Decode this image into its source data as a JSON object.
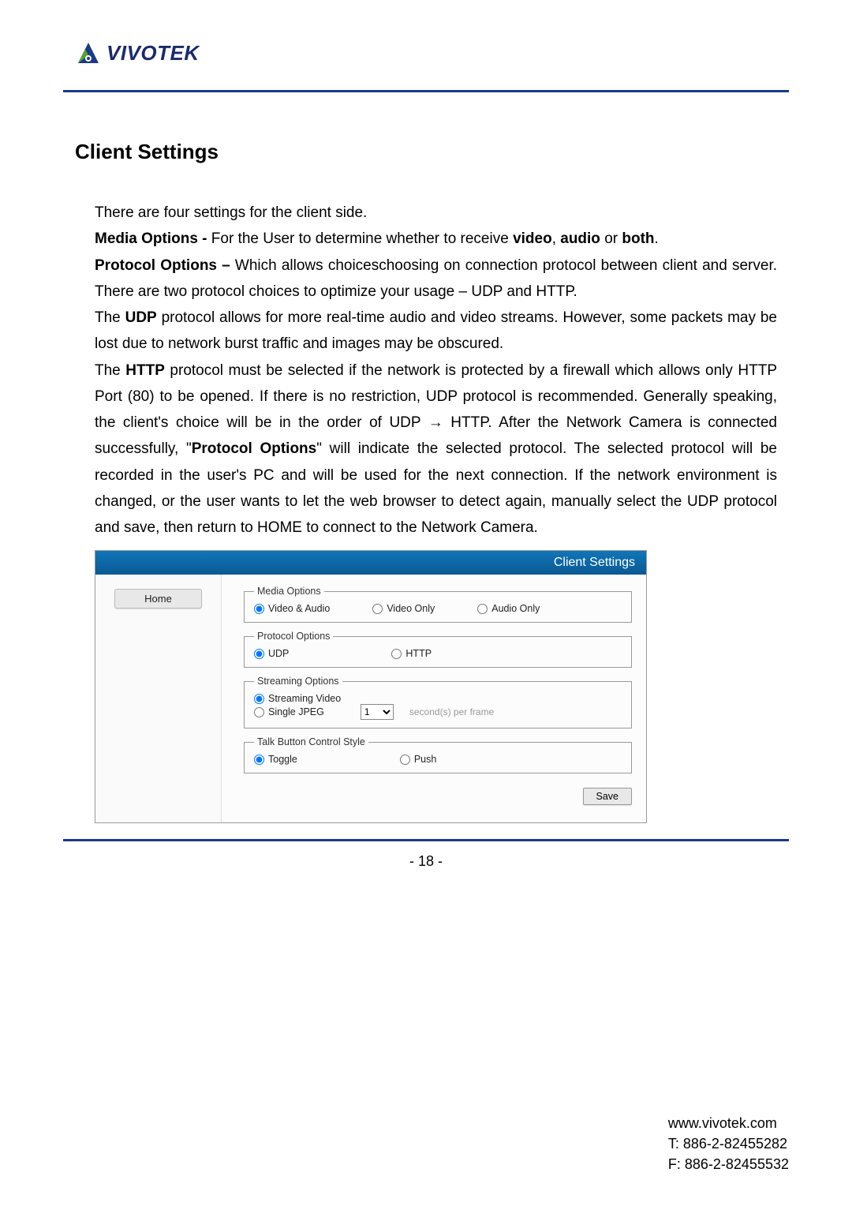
{
  "header": {
    "logo_text": "VIVOTEK"
  },
  "section": {
    "title": "Client Settings",
    "p1": "There are four settings for the client side.",
    "p2_label": "Media Options -",
    "p2_text": " For the User to determine whether to receive ",
    "p2_video": "video",
    "p2_comma": ", ",
    "p2_audio": "audio",
    "p2_or": " or ",
    "p2_both": "both",
    "p2_period": ".",
    "p3_label": "Protocol Options –",
    "p3_text": " Which allows choiceschoosing on connection protocol between client and server. There are two protocol choices to optimize your usage – UDP and HTTP.",
    "p4_pre": "The ",
    "p4_udp": "UDP",
    "p4_post": " protocol allows for more real-time audio and video streams. However, some packets may be lost due to network burst traffic and images may be obscured.",
    "p5_pre": "The ",
    "p5_http": "HTTP",
    "p5_mid": " protocol must be selected if the network is protected by a firewall which allows only HTTP Port (80) to be opened. If there is no restriction, UDP protocol is recommended. Generally speaking, the client's choice will be in the order of UDP → HTTP. After the Network Camera is connected successfully, \"",
    "p5_po": "Protocol Options",
    "p5_post": "\" will indicate the selected protocol. The selected protocol will be recorded in the user's PC and will be used for the next connection. If the network environment is changed, or the user wants to let the web browser to detect again, manually select the UDP protocol and save, then return to HOME to connect to the Network Camera."
  },
  "panel": {
    "header_title": "Client Settings",
    "home_label": "Home",
    "media": {
      "legend": "Media Options",
      "opt_va": "Video & Audio",
      "opt_vo": "Video Only",
      "opt_ao": "Audio Only"
    },
    "protocol": {
      "legend": "Protocol Options",
      "opt_udp": "UDP",
      "opt_http": "HTTP"
    },
    "streaming": {
      "legend": "Streaming Options",
      "opt_sv": "Streaming Video",
      "opt_sj": "Single JPEG",
      "spf_value": "1",
      "spf_label": "second(s) per frame"
    },
    "talk": {
      "legend": "Talk Button Control Style",
      "opt_toggle": "Toggle",
      "opt_push": "Push"
    },
    "save_label": "Save"
  },
  "footer": {
    "page_number": "- 18 -",
    "url": "www.vivotek.com",
    "tel": "T: 886-2-82455282",
    "fax": "F: 886-2-82455532"
  }
}
